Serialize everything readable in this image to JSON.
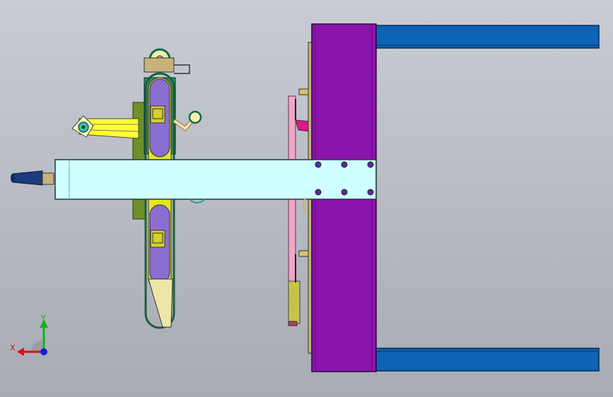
{
  "viewport": {
    "background_top": "#c9ccd3",
    "background_bottom": "#a7abb4"
  },
  "colors": {
    "frame_purple": "#8b14ad",
    "rail_blue": "#0d63b5",
    "beam_cyan": "#cfffff",
    "belt_yellow": "#e8e61e",
    "roller_purple": "#8a6fd0",
    "bracket_tan": "#c8b27a",
    "plate_olive": "#6f8f2a",
    "pink_rod": "#f0a6c8",
    "magenta_part": "#e0168c",
    "handle_navy": "#1c3b7a",
    "axis_x": "#e01010",
    "axis_y": "#18b018",
    "axis_z": "#1020e0"
  },
  "triad": {
    "x_label": "X",
    "y_label": "Y"
  }
}
